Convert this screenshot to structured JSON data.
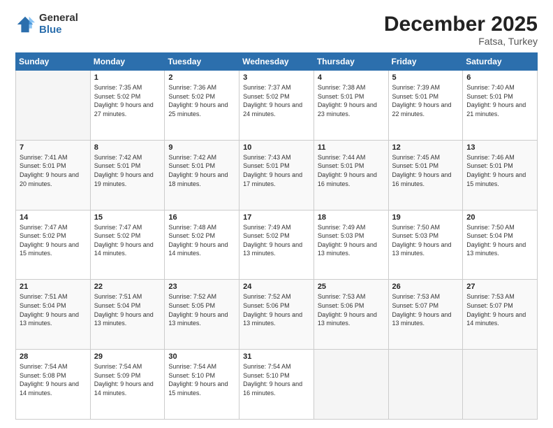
{
  "logo": {
    "general": "General",
    "blue": "Blue"
  },
  "header": {
    "title": "December 2025",
    "subtitle": "Fatsa, Turkey"
  },
  "weekdays": [
    "Sunday",
    "Monday",
    "Tuesday",
    "Wednesday",
    "Thursday",
    "Friday",
    "Saturday"
  ],
  "weeks": [
    [
      {
        "day": "",
        "empty": true
      },
      {
        "day": "1",
        "sunrise": "Sunrise: 7:35 AM",
        "sunset": "Sunset: 5:02 PM",
        "daylight": "Daylight: 9 hours and 27 minutes."
      },
      {
        "day": "2",
        "sunrise": "Sunrise: 7:36 AM",
        "sunset": "Sunset: 5:02 PM",
        "daylight": "Daylight: 9 hours and 25 minutes."
      },
      {
        "day": "3",
        "sunrise": "Sunrise: 7:37 AM",
        "sunset": "Sunset: 5:02 PM",
        "daylight": "Daylight: 9 hours and 24 minutes."
      },
      {
        "day": "4",
        "sunrise": "Sunrise: 7:38 AM",
        "sunset": "Sunset: 5:01 PM",
        "daylight": "Daylight: 9 hours and 23 minutes."
      },
      {
        "day": "5",
        "sunrise": "Sunrise: 7:39 AM",
        "sunset": "Sunset: 5:01 PM",
        "daylight": "Daylight: 9 hours and 22 minutes."
      },
      {
        "day": "6",
        "sunrise": "Sunrise: 7:40 AM",
        "sunset": "Sunset: 5:01 PM",
        "daylight": "Daylight: 9 hours and 21 minutes."
      }
    ],
    [
      {
        "day": "7",
        "sunrise": "Sunrise: 7:41 AM",
        "sunset": "Sunset: 5:01 PM",
        "daylight": "Daylight: 9 hours and 20 minutes."
      },
      {
        "day": "8",
        "sunrise": "Sunrise: 7:42 AM",
        "sunset": "Sunset: 5:01 PM",
        "daylight": "Daylight: 9 hours and 19 minutes."
      },
      {
        "day": "9",
        "sunrise": "Sunrise: 7:42 AM",
        "sunset": "Sunset: 5:01 PM",
        "daylight": "Daylight: 9 hours and 18 minutes."
      },
      {
        "day": "10",
        "sunrise": "Sunrise: 7:43 AM",
        "sunset": "Sunset: 5:01 PM",
        "daylight": "Daylight: 9 hours and 17 minutes."
      },
      {
        "day": "11",
        "sunrise": "Sunrise: 7:44 AM",
        "sunset": "Sunset: 5:01 PM",
        "daylight": "Daylight: 9 hours and 16 minutes."
      },
      {
        "day": "12",
        "sunrise": "Sunrise: 7:45 AM",
        "sunset": "Sunset: 5:01 PM",
        "daylight": "Daylight: 9 hours and 16 minutes."
      },
      {
        "day": "13",
        "sunrise": "Sunrise: 7:46 AM",
        "sunset": "Sunset: 5:01 PM",
        "daylight": "Daylight: 9 hours and 15 minutes."
      }
    ],
    [
      {
        "day": "14",
        "sunrise": "Sunrise: 7:47 AM",
        "sunset": "Sunset: 5:02 PM",
        "daylight": "Daylight: 9 hours and 15 minutes."
      },
      {
        "day": "15",
        "sunrise": "Sunrise: 7:47 AM",
        "sunset": "Sunset: 5:02 PM",
        "daylight": "Daylight: 9 hours and 14 minutes."
      },
      {
        "day": "16",
        "sunrise": "Sunrise: 7:48 AM",
        "sunset": "Sunset: 5:02 PM",
        "daylight": "Daylight: 9 hours and 14 minutes."
      },
      {
        "day": "17",
        "sunrise": "Sunrise: 7:49 AM",
        "sunset": "Sunset: 5:02 PM",
        "daylight": "Daylight: 9 hours and 13 minutes."
      },
      {
        "day": "18",
        "sunrise": "Sunrise: 7:49 AM",
        "sunset": "Sunset: 5:03 PM",
        "daylight": "Daylight: 9 hours and 13 minutes."
      },
      {
        "day": "19",
        "sunrise": "Sunrise: 7:50 AM",
        "sunset": "Sunset: 5:03 PM",
        "daylight": "Daylight: 9 hours and 13 minutes."
      },
      {
        "day": "20",
        "sunrise": "Sunrise: 7:50 AM",
        "sunset": "Sunset: 5:04 PM",
        "daylight": "Daylight: 9 hours and 13 minutes."
      }
    ],
    [
      {
        "day": "21",
        "sunrise": "Sunrise: 7:51 AM",
        "sunset": "Sunset: 5:04 PM",
        "daylight": "Daylight: 9 hours and 13 minutes."
      },
      {
        "day": "22",
        "sunrise": "Sunrise: 7:51 AM",
        "sunset": "Sunset: 5:04 PM",
        "daylight": "Daylight: 9 hours and 13 minutes."
      },
      {
        "day": "23",
        "sunrise": "Sunrise: 7:52 AM",
        "sunset": "Sunset: 5:05 PM",
        "daylight": "Daylight: 9 hours and 13 minutes."
      },
      {
        "day": "24",
        "sunrise": "Sunrise: 7:52 AM",
        "sunset": "Sunset: 5:06 PM",
        "daylight": "Daylight: 9 hours and 13 minutes."
      },
      {
        "day": "25",
        "sunrise": "Sunrise: 7:53 AM",
        "sunset": "Sunset: 5:06 PM",
        "daylight": "Daylight: 9 hours and 13 minutes."
      },
      {
        "day": "26",
        "sunrise": "Sunrise: 7:53 AM",
        "sunset": "Sunset: 5:07 PM",
        "daylight": "Daylight: 9 hours and 13 minutes."
      },
      {
        "day": "27",
        "sunrise": "Sunrise: 7:53 AM",
        "sunset": "Sunset: 5:07 PM",
        "daylight": "Daylight: 9 hours and 14 minutes."
      }
    ],
    [
      {
        "day": "28",
        "sunrise": "Sunrise: 7:54 AM",
        "sunset": "Sunset: 5:08 PM",
        "daylight": "Daylight: 9 hours and 14 minutes."
      },
      {
        "day": "29",
        "sunrise": "Sunrise: 7:54 AM",
        "sunset": "Sunset: 5:09 PM",
        "daylight": "Daylight: 9 hours and 14 minutes."
      },
      {
        "day": "30",
        "sunrise": "Sunrise: 7:54 AM",
        "sunset": "Sunset: 5:10 PM",
        "daylight": "Daylight: 9 hours and 15 minutes."
      },
      {
        "day": "31",
        "sunrise": "Sunrise: 7:54 AM",
        "sunset": "Sunset: 5:10 PM",
        "daylight": "Daylight: 9 hours and 16 minutes."
      },
      {
        "day": "",
        "empty": true
      },
      {
        "day": "",
        "empty": true
      },
      {
        "day": "",
        "empty": true
      }
    ]
  ]
}
